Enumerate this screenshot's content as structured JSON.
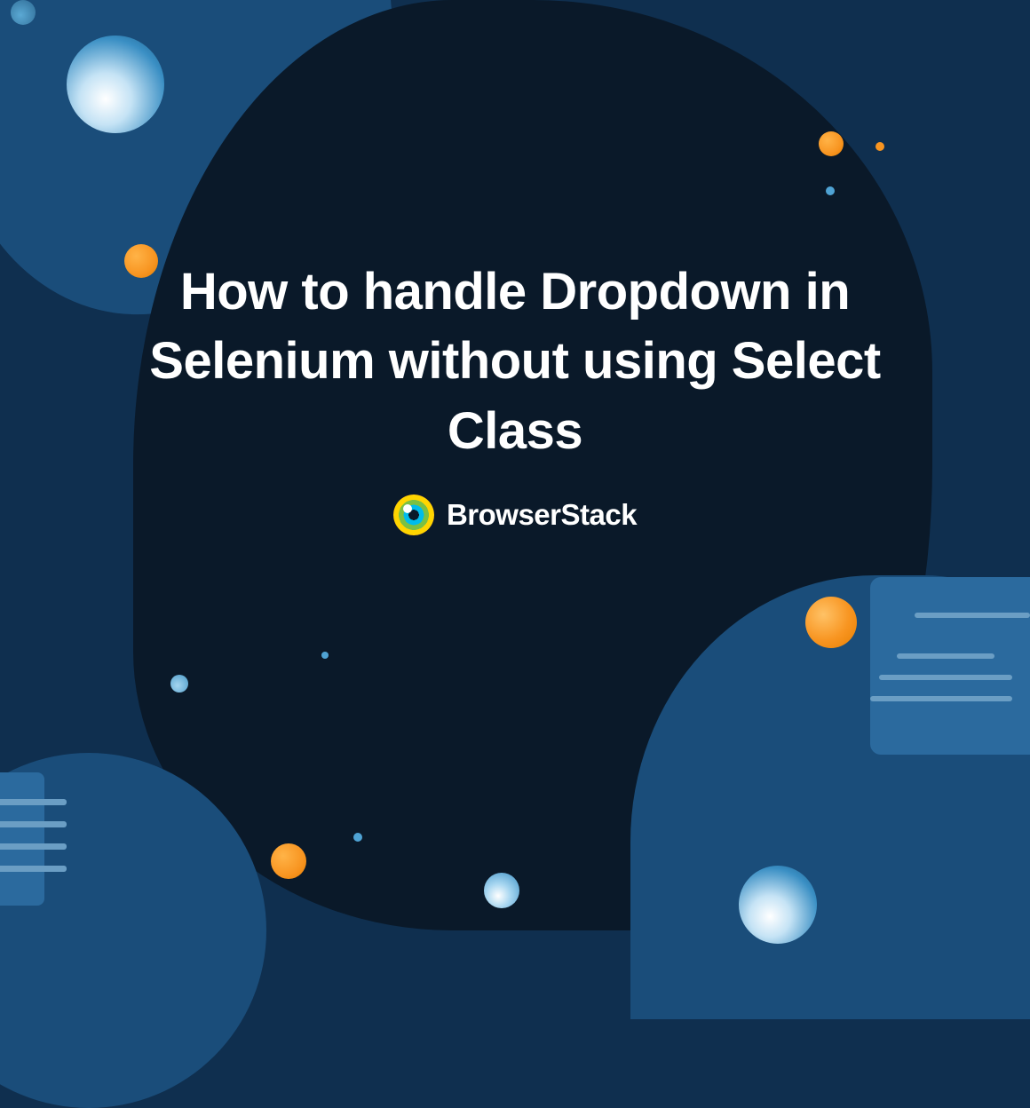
{
  "title": "How to handle Dropdown in Selenium without using Select Class",
  "brand": {
    "name": "BrowserStack"
  }
}
